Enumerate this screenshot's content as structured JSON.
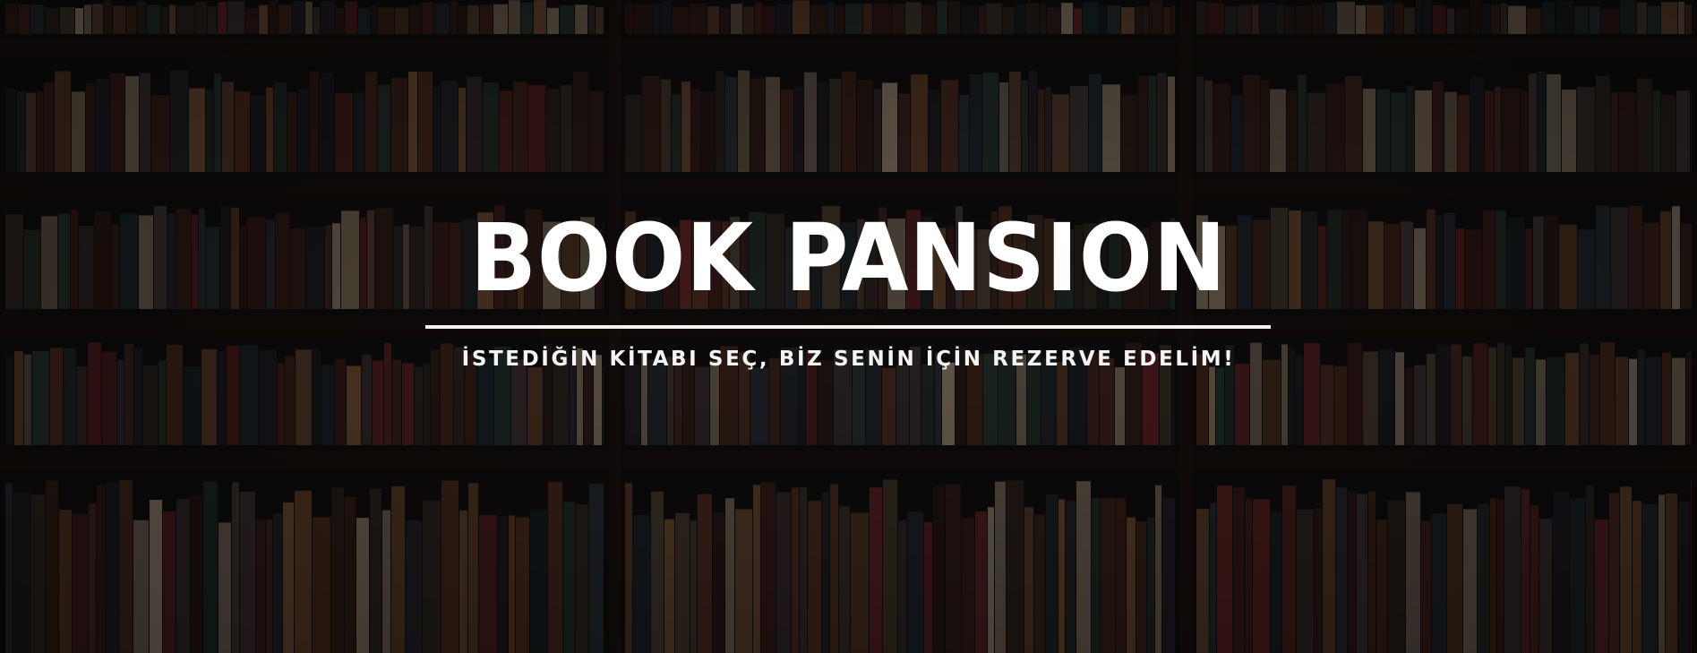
{
  "hero": {
    "title": "BOOK PANSION",
    "tagline": "İSTEDİĞİN KİTABI SEÇ, BİZ SENİN İÇİN REZERVE EDELİM!",
    "background": "dark-bookshelf-photo"
  },
  "colors": {
    "title": "#ffffff",
    "divider": "#f2f2f2",
    "background": "#0e0c0c",
    "shelf": "#1c1412"
  }
}
